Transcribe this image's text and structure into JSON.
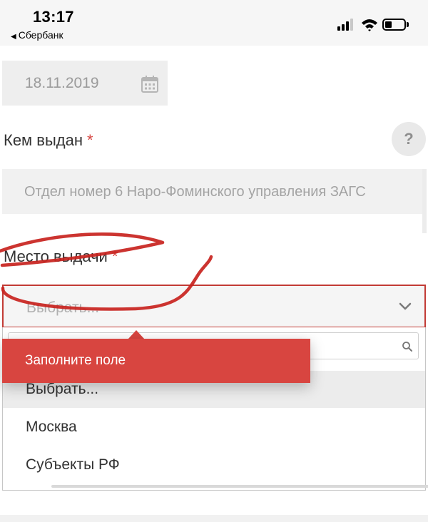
{
  "status_bar": {
    "time": "13:17",
    "back_app": "Сбербанк",
    "back_arrow": "◀"
  },
  "date_field": {
    "value": "18.11.2019",
    "icon": "calendar-icon"
  },
  "issuer": {
    "label": "Кем выдан",
    "required_mark": "*",
    "value": "Отдел номер 6 Наро-Фоминского управления ЗАГС",
    "help": "?"
  },
  "place_of_issue": {
    "label": "Место выдачи",
    "required_mark": "*",
    "selected": "Выбрать...",
    "options": [
      "Выбрать...",
      "Москва",
      "Субъекты РФ"
    ],
    "error_tooltip": "Заполните поле"
  },
  "colors": {
    "error": "#d84540",
    "required": "#d64541",
    "annotation": "#c8231e"
  }
}
